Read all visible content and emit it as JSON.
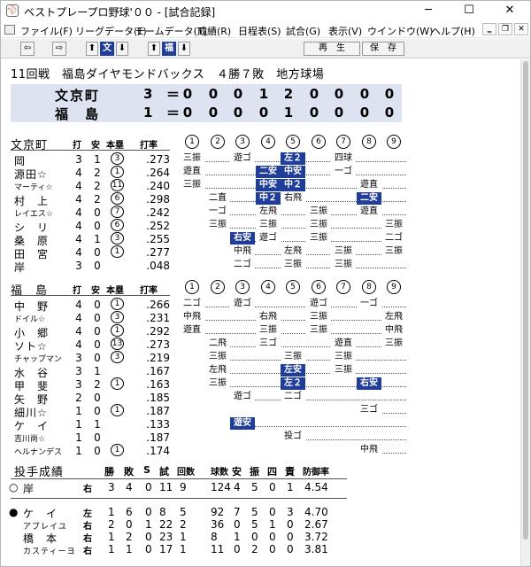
{
  "window": {
    "title": "ベストプレープロ野球'００ - [試合記録]",
    "app_icon": "baseball-cap-icon"
  },
  "menu": [
    "ファイル(F)",
    "リーグデータ(L)",
    "チームデータ(T)",
    "成績(R)",
    "日程表(S)",
    "試合(G)",
    "表示(V)",
    "ウインドウ(W)",
    "ヘルプ(H)"
  ],
  "toolbar": {
    "team1": "文",
    "team2": "福",
    "play_label": "再　生",
    "save_label": "保　存"
  },
  "game_header": "11回戦　福島ダイヤモンドバックス　４勝７敗　地方球場",
  "linescore": [
    {
      "team": "文京町",
      "runs": "3",
      "eq": "＝",
      "innings": [
        "0",
        "0",
        "0",
        "1",
        "2",
        "0",
        "0",
        "0",
        "0"
      ]
    },
    {
      "team": "福　島",
      "runs": "1",
      "eq": "＝",
      "innings": [
        "0",
        "0",
        "0",
        "0",
        "1",
        "0",
        "0",
        "0",
        "0"
      ]
    }
  ],
  "batting_headers": {
    "at_bats": "打",
    "hits": "安",
    "hr": "本塁",
    "avg": "打率"
  },
  "innings_labels": [
    "1",
    "2",
    "3",
    "4",
    "5",
    "6",
    "7",
    "8",
    "9"
  ],
  "teams": [
    {
      "name": "文京町",
      "players": [
        {
          "name": "岡",
          "ab": "3",
          "h": "1",
          "hr": "3",
          "avg": ".273",
          "pa": [
            [
              "三振",
              0,
              0
            ],
            [
              "遊ゴ",
              2,
              0
            ],
            [
              "左２",
              4,
              1
            ],
            [
              "四球",
              6,
              0
            ]
          ]
        },
        {
          "name": "源田☆",
          "ab": "4",
          "h": "2",
          "hr": "1",
          "avg": ".264",
          "pa": [
            [
              "遊直",
              0,
              0
            ],
            [
              "二安",
              3,
              1
            ],
            [
              "中安",
              4,
              1
            ],
            [
              "一ゴ",
              6,
              0
            ]
          ]
        },
        {
          "name": "マーティ☆",
          "ab": "4",
          "h": "2",
          "hr": "11",
          "avg": ".240",
          "small": true,
          "pa": [
            [
              "三振",
              0,
              0
            ],
            [
              "中安",
              3,
              1
            ],
            [
              "中２",
              4,
              1
            ],
            [
              "遊直",
              7,
              0
            ]
          ]
        },
        {
          "name": "村　上",
          "ab": "4",
          "h": "2",
          "hr": "6",
          "avg": ".298",
          "pa": [
            [
              "二直",
              1,
              0
            ],
            [
              "中２",
              3,
              1
            ],
            [
              "右飛",
              4,
              0
            ],
            [
              "二安",
              7,
              1
            ]
          ]
        },
        {
          "name": "レイエス☆",
          "ab": "4",
          "h": "0",
          "hr": "7",
          "avg": ".242",
          "small": true,
          "pa": [
            [
              "一ゴ",
              1,
              0
            ],
            [
              "左飛",
              3,
              0
            ],
            [
              "三振",
              5,
              0
            ],
            [
              "遊直",
              7,
              0
            ]
          ]
        },
        {
          "name": "シ　リ",
          "ab": "4",
          "h": "0",
          "hr": "6",
          "avg": ".252",
          "pa": [
            [
              "三振",
              1,
              0
            ],
            [
              "三振",
              3,
              0
            ],
            [
              "三振",
              5,
              0
            ],
            [
              "三振",
              8,
              0
            ]
          ]
        },
        {
          "name": "桑　原",
          "ab": "4",
          "h": "1",
          "hr": "3",
          "avg": ".255",
          "pa": [
            [
              "右安",
              2,
              1
            ],
            [
              "遊ゴ",
              3,
              0
            ],
            [
              "三振",
              5,
              0
            ],
            [
              "二ゴ",
              8,
              0
            ]
          ]
        },
        {
          "name": "田　宮",
          "ab": "4",
          "h": "0",
          "hr": "1",
          "avg": ".277",
          "pa": [
            [
              "中飛",
              2,
              0
            ],
            [
              "左飛",
              4,
              0
            ],
            [
              "三振",
              6,
              0
            ],
            [
              "三振",
              8,
              0
            ]
          ]
        },
        {
          "name": "岸",
          "ab": "3",
          "h": "0",
          "hr": "",
          "avg": ".048",
          "pa": [
            [
              "二ゴ",
              2,
              0
            ],
            [
              "三振",
              4,
              0
            ],
            [
              "三振",
              6,
              0
            ]
          ]
        }
      ]
    },
    {
      "name": "福　島",
      "players": [
        {
          "name": "中　野",
          "ab": "4",
          "h": "0",
          "hr": "1",
          "avg": ".266",
          "pa": [
            [
              "二ゴ",
              0,
              0
            ],
            [
              "遊ゴ",
              2,
              0
            ],
            [
              "遊ゴ",
              5,
              0
            ],
            [
              "一ゴ",
              7,
              0
            ]
          ]
        },
        {
          "name": "ドイル☆",
          "ab": "4",
          "h": "0",
          "hr": "3",
          "avg": ".231",
          "small": true,
          "pa": [
            [
              "中飛",
              0,
              0
            ],
            [
              "右飛",
              3,
              0
            ],
            [
              "三振",
              5,
              0
            ],
            [
              "左飛",
              8,
              0
            ]
          ]
        },
        {
          "name": "小　郷",
          "ab": "4",
          "h": "0",
          "hr": "1",
          "avg": ".292",
          "pa": [
            [
              "遊直",
              0,
              0
            ],
            [
              "三振",
              3,
              0
            ],
            [
              "三振",
              5,
              0
            ],
            [
              "中飛",
              8,
              0
            ]
          ]
        },
        {
          "name": "ソト☆",
          "ab": "4",
          "h": "0",
          "hr": "13",
          "avg": ".273",
          "pa": [
            [
              "二飛",
              1,
              0
            ],
            [
              "三ゴ",
              3,
              0
            ],
            [
              "遊直",
              6,
              0
            ],
            [
              "三振",
              8,
              0
            ]
          ]
        },
        {
          "name": "チャップマン",
          "ab": "3",
          "h": "0",
          "hr": "3",
          "avg": ".219",
          "small": true,
          "pa": [
            [
              "三振",
              1,
              0
            ],
            [
              "三振",
              4,
              0
            ],
            [
              "三振",
              6,
              0
            ]
          ]
        },
        {
          "name": "水　谷",
          "ab": "3",
          "h": "1",
          "hr": "",
          "avg": ".167",
          "pa": [
            [
              "左飛",
              1,
              0
            ],
            [
              "左安",
              4,
              1
            ],
            [
              "三振",
              6,
              0
            ]
          ]
        },
        {
          "name": "甲　斐",
          "ab": "3",
          "h": "2",
          "hr": "1",
          "avg": ".163",
          "pa": [
            [
              "三振",
              1,
              0
            ],
            [
              "左２",
              4,
              1
            ],
            [
              "右安",
              7,
              1
            ]
          ]
        },
        {
          "name": "矢　野",
          "ab": "2",
          "h": "0",
          "hr": "",
          "avg": ".185",
          "pa": [
            [
              "遊ゴ",
              2,
              0
            ],
            [
              "二ゴ",
              4,
              0
            ]
          ]
        },
        {
          "name": "細川☆",
          "ab": "1",
          "h": "0",
          "hr": "1",
          "avg": ".187",
          "pa": [
            [
              "三ゴ",
              7,
              0
            ]
          ]
        },
        {
          "name": "ケ　イ",
          "ab": "1",
          "h": "1",
          "hr": "",
          "avg": ".133",
          "pa": [
            [
              "遊安",
              2,
              1
            ]
          ]
        },
        {
          "name": "吉川尚☆",
          "ab": "1",
          "h": "0",
          "hr": "",
          "avg": ".187",
          "small": true,
          "pa": [
            [
              "投ゴ",
              4,
              0
            ]
          ]
        },
        {
          "name": "ヘルナンデス",
          "ab": "1",
          "h": "0",
          "hr": "1",
          "avg": ".174",
          "small": true,
          "pa": [
            [
              "中飛",
              7,
              0
            ]
          ]
        }
      ]
    }
  ],
  "pitching": {
    "title": "投手成績",
    "headers": [
      "勝",
      "敗",
      "S",
      "試",
      "回数",
      "球数",
      "安",
      "振",
      "四",
      "責",
      "防御率"
    ],
    "pitchers": [
      {
        "mark": "○",
        "name": "岸",
        "hand": "右",
        "w": "3",
        "l": "4",
        "s": "0",
        "g": "11",
        "ip": "9",
        "np": "124",
        "h": "4",
        "so": "5",
        "bb": "0",
        "er": "1",
        "era": "4.54"
      },
      {
        "mark": "●",
        "name": "ケ　イ",
        "hand": "左",
        "w": "1",
        "l": "6",
        "s": "0",
        "g": "8",
        "ip": "5",
        "np": "92",
        "h": "7",
        "so": "5",
        "bb": "0",
        "er": "3",
        "era": "4.70"
      },
      {
        "mark": "",
        "name": "アブレイユ",
        "hand": "右",
        "w": "2",
        "l": "0",
        "s": "1",
        "g": "22",
        "ip": "2",
        "np": "36",
        "h": "0",
        "so": "5",
        "bb": "1",
        "er": "0",
        "era": "2.67",
        "small": true
      },
      {
        "mark": "",
        "name": "橋　本",
        "hand": "右",
        "w": "1",
        "l": "2",
        "s": "0",
        "g": "23",
        "ip": "1",
        "np": "8",
        "h": "1",
        "so": "0",
        "bb": "0",
        "er": "0",
        "era": "3.72"
      },
      {
        "mark": "",
        "name": "カスティーヨ",
        "hand": "右",
        "w": "1",
        "l": "1",
        "s": "0",
        "g": "17",
        "ip": "1",
        "np": "11",
        "h": "0",
        "so": "2",
        "bb": "0",
        "er": "0",
        "era": "3.81",
        "small": true
      }
    ]
  },
  "colors": {
    "hit_bg": "#1f3d99",
    "linescore_bg": "#dde3f1"
  }
}
